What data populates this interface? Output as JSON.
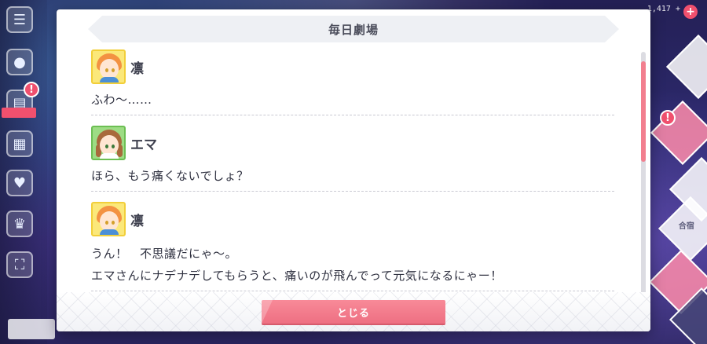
{
  "modal": {
    "title": "毎日劇場",
    "close_label": "とじる"
  },
  "entries": [
    {
      "speaker": "凛",
      "avatar": "rin-avatar",
      "lines": [
        "ふわ〜……"
      ]
    },
    {
      "speaker": "エマ",
      "avatar": "emma-avatar",
      "lines": [
        "ほら、もう痛くないでしょ？"
      ]
    },
    {
      "speaker": "凛",
      "avatar": "rin-avatar",
      "lines": [
        "うん！　不思議だにゃ〜。",
        "エマさんにナデナデしてもらうと、痛いのが飛んでって元気になるにゃー！"
      ]
    }
  ],
  "background": {
    "left_icons": [
      "menu-icon",
      "chat-icon",
      "present-icon",
      "gift-icon",
      "heart-icon",
      "trophy-icon",
      "fullscreen-icon"
    ],
    "right_labels": [
      "合宿"
    ],
    "top_counter": "1,417 +",
    "accent_color": "#f27f8f",
    "alert_color": "#f0506e"
  }
}
